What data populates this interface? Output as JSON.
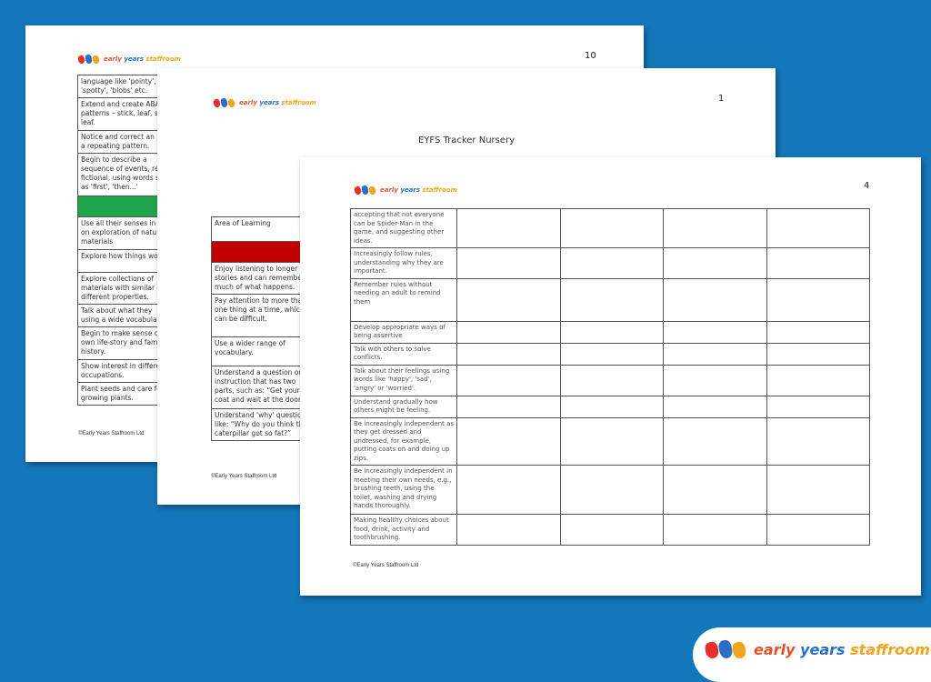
{
  "brand": {
    "word1": "early",
    "word2": "years",
    "word3": "staffroom"
  },
  "colors": {
    "background": "#1476bb",
    "green_bar": "#1ea54a",
    "red_bar": "#c00000"
  },
  "page_back": {
    "page_number": "10",
    "rows": [
      "language like 'pointy', 'spotty', 'blobs' etc.",
      "Extend and create ABA patterns – stick, leaf, s leaf.",
      "Notice and correct an in a repeating pattern.",
      "Begin to describe a sequence of events, rea fictional, using words s as 'first', 'then...'",
      "",
      "Use all their senses in on exploration of natu materials",
      "Explore how things wo",
      "Explore collections of materials with similar d different properties.",
      "Talk about what they using a wide vocabula",
      "Begin to make sense o own life-story and fam history.",
      "Show interest in differe occupations.",
      "Plant seeds and care fo growing plants."
    ],
    "footer": "©Early Years Staffroom Ltd"
  },
  "page_middle": {
    "page_number": "1",
    "title": "EYFS Tracker Nursery",
    "rows": [
      "Area of Learning",
      "",
      "Enjoy listening to longer stories and can remember much of what happens.",
      "Pay attention to more tha one thing at a time, which can be difficult.",
      "Use a wider range of vocabulary.",
      "Understand a question or instruction that has two parts, such as: “Get your coat and wait at the door",
      "Understand 'why' questio like: “Why do you think th caterpillar got so fat?”"
    ],
    "footer": "©Early Years Staffroom Ltd"
  },
  "page_front": {
    "page_number": "4",
    "rows": [
      "accepting that not everyone can be Spider-Man in the game, and suggesting other ideas.",
      "Increasingly follow rules, understanding why they are important.",
      "Remember rules without needing an adult to remind them",
      "Develop appropriate ways of being assertive",
      "Talk with others to solve conflicts.",
      "Talk about their feelings using words like 'happy', 'sad', 'angry' or 'worried'.",
      "Understand gradually how others might be feeling.",
      "Be increasingly independent as they get dressed and undressed, for example, putting coats on and doing up zips.",
      "Be increasingly independent in meeting their own needs, e.g., brushing teeth, using the toilet, washing and drying hands thoroughly.",
      "Making healthy choices about food, drink, activity and toothbrushing."
    ],
    "footer": "©Early Years Staffroom Ltd"
  }
}
